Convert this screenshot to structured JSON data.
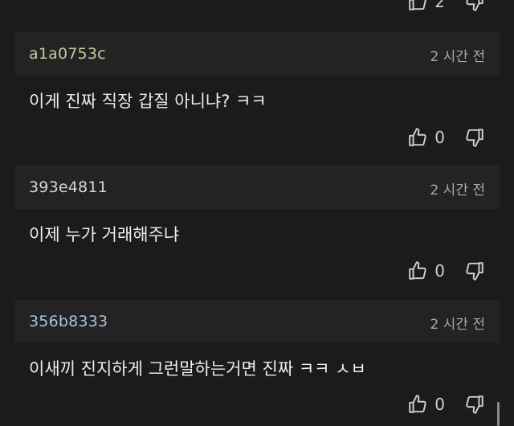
{
  "colors": {
    "background": "#1b1b1b",
    "header": "#232323",
    "username_1": "#c9c7a0",
    "username_2": "#d6d6d6",
    "username_3": "#a9c3dc"
  },
  "top_partial": {
    "like_count": "2"
  },
  "comments": [
    {
      "user": "a1a0753c",
      "time": "2 시간 전",
      "text": "이게 진짜 직장 갑질 아니냐? ㅋㅋ",
      "like_count": "0"
    },
    {
      "user": "393e4811",
      "time": "2 시간 전",
      "text": "이제 누가 거래해주냐",
      "like_count": "0"
    },
    {
      "user": "356b8333",
      "time": "2 시간 전",
      "text": "이새끼 진지하게 그런말하는거면 진짜 ㅋㅋ ㅅㅂ",
      "like_count": "0"
    }
  ],
  "icons": {
    "like": "thumbs-up-icon",
    "dislike": "thumbs-down-icon"
  }
}
